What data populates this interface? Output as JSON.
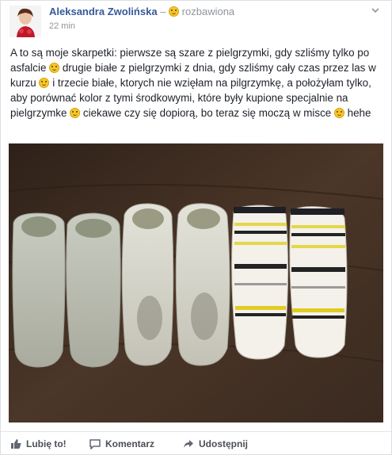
{
  "post": {
    "author": "Aleksandra Zwolińska",
    "feeling_separator": "–",
    "feeling": "rozbawiona",
    "timestamp": "22 min",
    "text_parts": [
      "A to są moje skarpetki: pierwsze są szare z pielgrzymki, gdy szliśmy tylko po asfalcie ",
      " drugie białe z pielgrzymki z dnia, gdy szliśmy cały czas przez las w kurzu ",
      " i trzecie białe, ktorych nie wzięłam na pilgrzymkę, a położyłam tylko, aby porównać kolor z tymi środkowymi, które były kupione specjalnie na pielgrzymke ",
      " ciekawe czy się dopiorą, bo teraz się moczą w misce ",
      " hehe"
    ]
  },
  "photo": {
    "description_icon": "socks-photo",
    "background_color": "#3e2d22"
  },
  "actions": {
    "like": "Lubię to!",
    "comment": "Komentarz",
    "share": "Udostępnij"
  }
}
